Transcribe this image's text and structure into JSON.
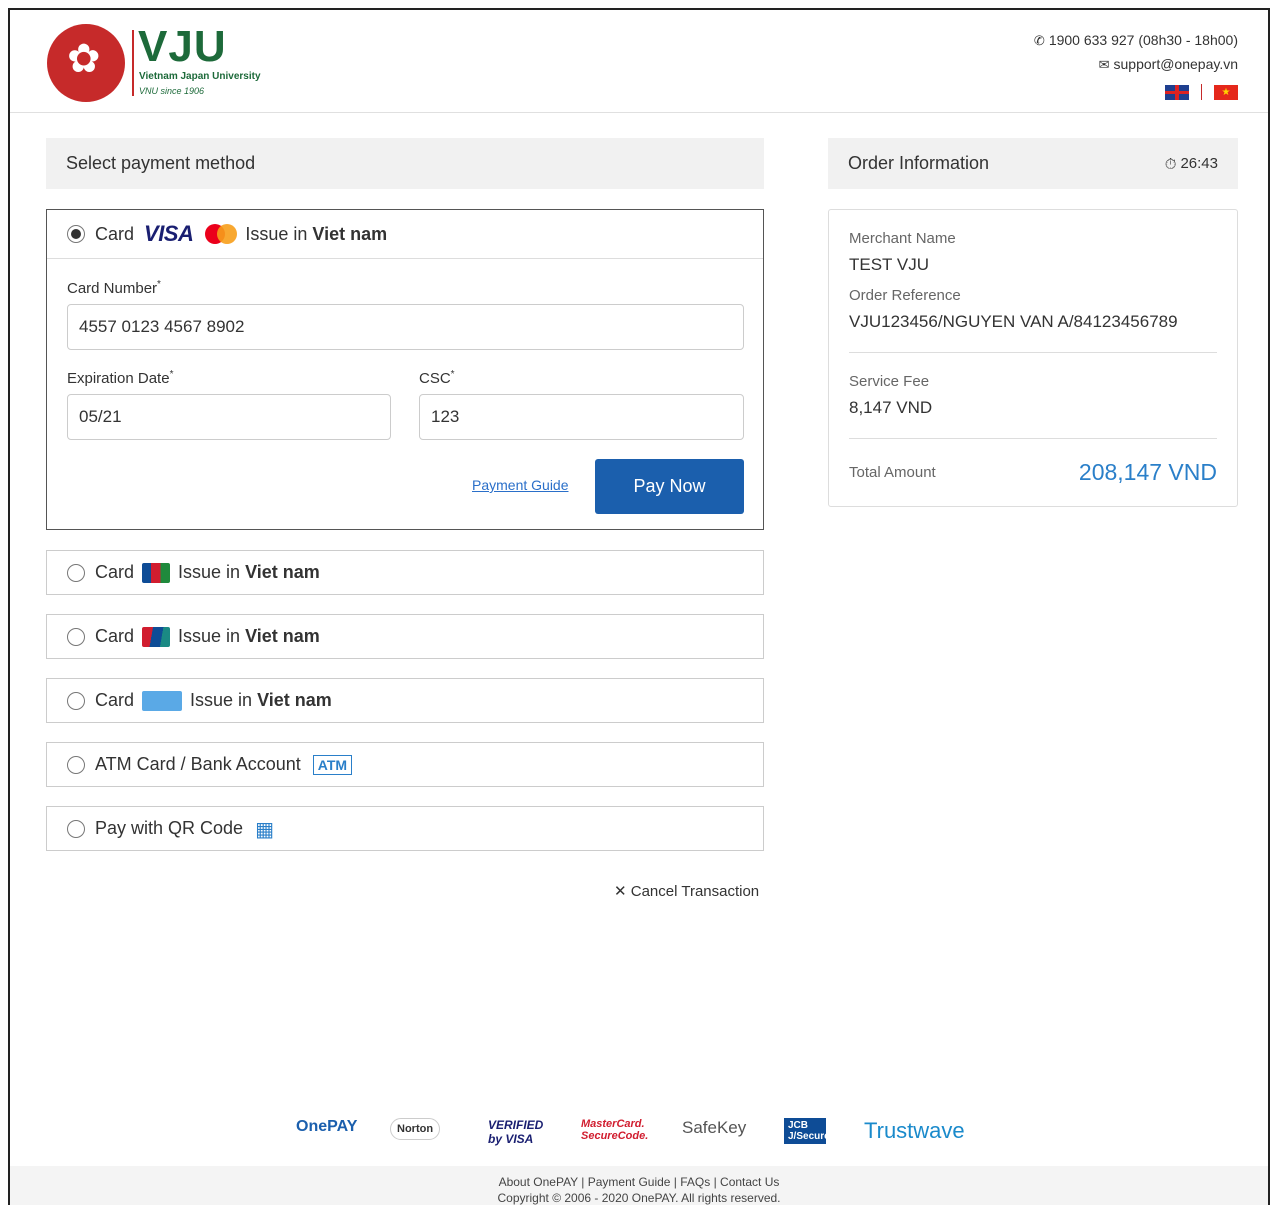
{
  "header": {
    "logo_text": "VJU",
    "logo_subtitle": "Vietnam Japan University",
    "logo_since": "VNU since 1906",
    "phone": "1900 633 927 (08h30 - 18h00)",
    "email": "support@onepay.vn"
  },
  "payment_method": {
    "title": "Select payment method",
    "active_option": {
      "card_label": "Card",
      "visa_text": "VISA",
      "issue_in": "Issue in",
      "issue_country": "Viet nam",
      "card_number_label": "Card Number",
      "card_number_value": "4557 0123 4567 8902",
      "expiration_label": "Expiration Date",
      "expiration_value": "05/21",
      "csc_label": "CSC",
      "csc_value": "123",
      "required_mark": "*",
      "payment_guide": "Payment Guide",
      "pay_now": "Pay Now"
    },
    "options": [
      {
        "label": "Card",
        "icon": "jcb-icon",
        "issue_in": "Issue in",
        "country": "Viet nam"
      },
      {
        "label": "Card",
        "icon": "unionpay-icon",
        "issue_in": "Issue in",
        "country": "Viet nam"
      },
      {
        "label": "Card",
        "icon": "amex-icon",
        "issue_in": "Issue in",
        "country": "Viet nam"
      },
      {
        "label": "ATM Card / Bank Account",
        "badge": "ATM"
      },
      {
        "label": "Pay with QR Code",
        "icon": "qr-code-icon"
      }
    ],
    "cancel": "Cancel Transaction"
  },
  "order": {
    "title": "Order Information",
    "timer": "26:43",
    "merchant_label": "Merchant Name",
    "merchant_value": "TEST VJU",
    "reference_label": "Order Reference",
    "reference_value": "VJU123456/NGUYEN VAN A/84123456789",
    "fee_label": "Service Fee",
    "fee_value": "8,147 VND",
    "total_label": "Total Amount",
    "total_value": "208,147 VND"
  },
  "footer_logos": {
    "onepay": "OnePAY",
    "norton": "Norton",
    "verified": "VERIFIED by VISA",
    "mastercard": "MasterCard. SecureCode.",
    "safekey": "SafeKey",
    "jcb": "JCB J/Secure",
    "trustwave": "Trustwave"
  },
  "footer": {
    "links": "About OnePAY | Payment Guide | FAQs | Contact Us",
    "copyright": "Copyright © 2006 - 2020 OnePAY. All rights reserved."
  },
  "colors": {
    "primary": "#1b5fad",
    "accent": "#2a7fc9",
    "brand_red": "#c62a2a",
    "brand_green": "#1d6a3a"
  }
}
